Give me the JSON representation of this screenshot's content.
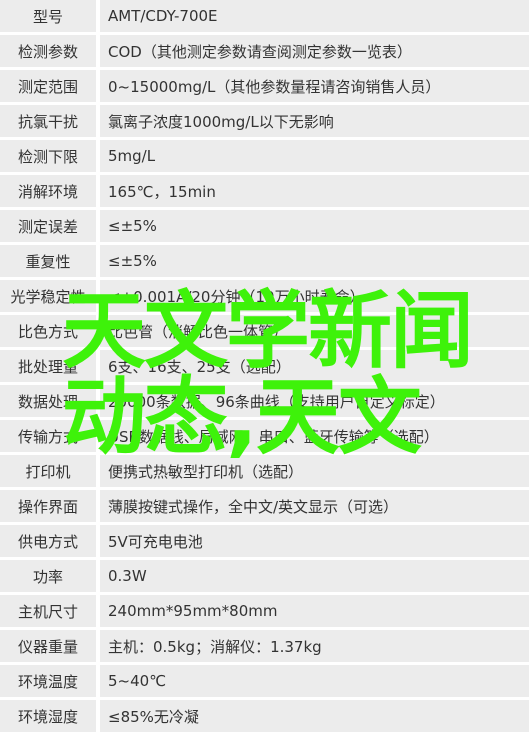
{
  "rows": [
    {
      "label": "型号",
      "value": "AMT/CDY-700E"
    },
    {
      "label": "检测参数",
      "value": "COD（其他测定参数请查阅测定参数一览表）"
    },
    {
      "label": "测定范围",
      "value": "0~15000mg/L（其他参数量程请咨询销售人员）"
    },
    {
      "label": "抗氯干扰",
      "value": "氯离子浓度1000mg/L以下无影响"
    },
    {
      "label": "检测下限",
      "value": "5mg/L"
    },
    {
      "label": "消解环境",
      "value": "165℃，15min"
    },
    {
      "label": "测定误差",
      "value": "≤±5%"
    },
    {
      "label": "重复性",
      "value": "≤±5%"
    },
    {
      "label": "光学稳定性",
      "value": "≤±0.001A/20分钟（10万小时寿命）"
    },
    {
      "label": "比色方式",
      "value": "比色管（消解比色一体管）"
    },
    {
      "label": "批处理量",
      "value": "6支、16支、25支（选配）"
    },
    {
      "label": "数据处理",
      "value": "20000条数据、96条曲线（支持用户自定义标定）"
    },
    {
      "label": "传输方式",
      "value": "USB数据线、局域网、串口、蓝牙传输等（选配）"
    },
    {
      "label": "打印机",
      "value": "便携式热敏型打印机（选配）"
    },
    {
      "label": "操作界面",
      "value": "薄膜按键式操作，全中文/英文显示（可选）"
    },
    {
      "label": "供电方式",
      "value": "5V可充电电池"
    },
    {
      "label": "功率",
      "value": "0.3W"
    },
    {
      "label": "主机尺寸",
      "value": "240mm*95mm*80mm"
    },
    {
      "label": "仪器重量",
      "value": "主机：0.5kg；消解仪：1.37kg"
    },
    {
      "label": "环境温度",
      "value": "5~40℃"
    },
    {
      "label": "环境湿度",
      "value": "≤85%无冷凝"
    }
  ],
  "overlay": {
    "line1": "天文学新闻",
    "line2": "动态,天文",
    "color": "#3ef20a"
  }
}
